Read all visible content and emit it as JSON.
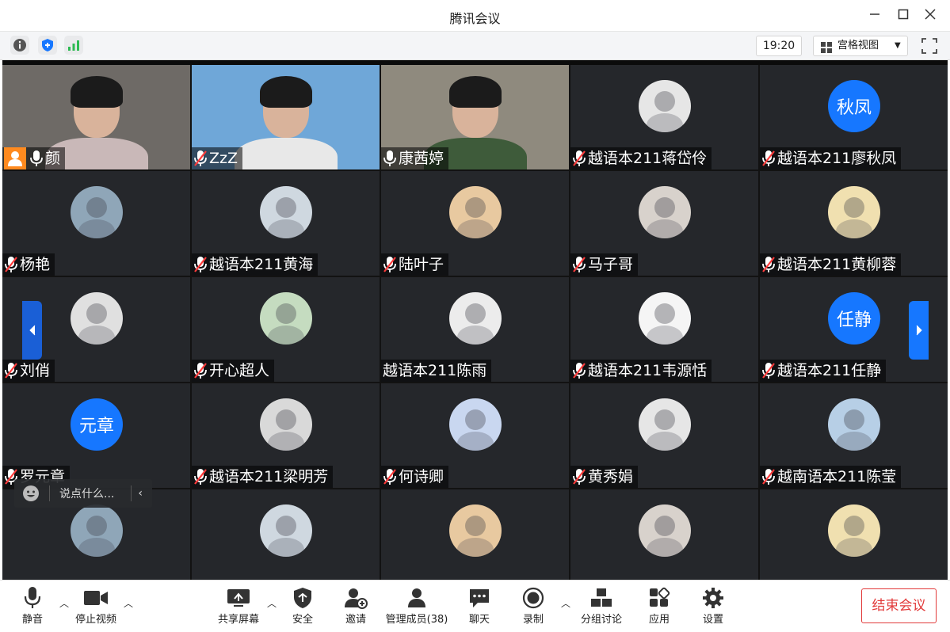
{
  "window": {
    "title": "腾讯会议"
  },
  "topbar": {
    "time": "19:20",
    "view_label": "宫格视图"
  },
  "tiles": [
    {
      "name": "颜",
      "type": "video",
      "mic": "on",
      "host": true
    },
    {
      "name": "ZzZ",
      "type": "video",
      "mic": "muted"
    },
    {
      "name": "康茜婷",
      "type": "video",
      "mic": "on",
      "speaking": true
    },
    {
      "name": "越语本211蒋岱伶",
      "type": "avatar",
      "mic": "muted"
    },
    {
      "name": "越语本211廖秋凤",
      "type": "text-avatar",
      "avatar_text": "秋凤",
      "mic": "muted"
    },
    {
      "name": "杨艳",
      "type": "avatar",
      "mic": "muted"
    },
    {
      "name": "越语本211黄海",
      "type": "avatar",
      "mic": "muted"
    },
    {
      "name": "陆叶子",
      "type": "avatar",
      "mic": "muted"
    },
    {
      "name": "马子哥",
      "type": "avatar",
      "mic": "muted"
    },
    {
      "name": "越语本211黄柳蓉",
      "type": "avatar",
      "mic": "muted"
    },
    {
      "name": "刘俏",
      "type": "avatar",
      "mic": "muted"
    },
    {
      "name": "开心超人",
      "type": "avatar",
      "mic": "muted"
    },
    {
      "name": "越语本211陈雨",
      "type": "avatar",
      "mic": "none"
    },
    {
      "name": "越语本211韦源恬",
      "type": "avatar",
      "mic": "muted"
    },
    {
      "name": "越语本211任静",
      "type": "text-avatar",
      "avatar_text": "任静",
      "mic": "muted"
    },
    {
      "name": "罗元章",
      "type": "text-avatar",
      "avatar_text": "元章",
      "mic": "muted"
    },
    {
      "name": "越语本211梁明芳",
      "type": "avatar",
      "mic": "muted"
    },
    {
      "name": "何诗卿",
      "type": "avatar",
      "mic": "muted"
    },
    {
      "name": "黄秀娟",
      "type": "avatar",
      "mic": "muted"
    },
    {
      "name": "越南语本211陈莹",
      "type": "avatar",
      "mic": "muted"
    },
    {
      "name": "",
      "type": "avatar",
      "mic": "none"
    },
    {
      "name": "",
      "type": "avatar",
      "mic": "none"
    },
    {
      "name": "",
      "type": "avatar",
      "mic": "none"
    },
    {
      "name": "",
      "type": "avatar",
      "mic": "none"
    },
    {
      "name": "",
      "type": "avatar",
      "mic": "none"
    }
  ],
  "chat": {
    "placeholder": "说点什么..."
  },
  "bottombar": {
    "mute": "静音",
    "stop_video": "停止视频",
    "share_screen": "共享屏幕",
    "security": "安全",
    "invite": "邀请",
    "manage_members": "管理成员(38)",
    "chat": "聊天",
    "record": "录制",
    "breakout": "分组讨论",
    "apps": "应用",
    "settings": "设置",
    "end_meeting": "结束会议"
  },
  "colors": {
    "accent": "#1677ff",
    "danger": "#e23b3b",
    "speaking": "#35c25a",
    "host": "#ff8a1f"
  }
}
